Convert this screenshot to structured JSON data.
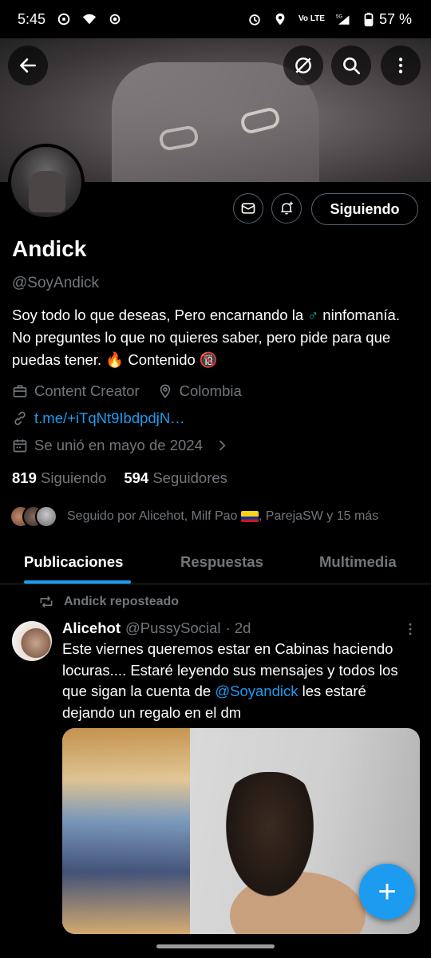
{
  "status_bar": {
    "time": "5:45",
    "battery": "57 %",
    "network": "5G",
    "volte": "Vo LTE",
    "icons": [
      "uber-icon",
      "wifi-icon",
      "hotspot-icon",
      "alarm-icon",
      "location-icon",
      "signal-icon",
      "battery-icon"
    ]
  },
  "header": {
    "back_icon": "arrow-left-icon",
    "grok_icon": "grok-icon",
    "search_icon": "search-icon",
    "more_icon": "more-vertical-icon"
  },
  "profile": {
    "name": "Andick",
    "handle": "@SoyAndick",
    "bio_part1": "Soy todo lo que deseas, Pero encarnando la ",
    "bio_male_sign": "♂",
    "bio_part2": " ninfomanía. No preguntes lo que no quieres saber, pero pide para que puedas tener. 🔥 Contenido 🔞",
    "category": "Content Creator",
    "location": "Colombia",
    "link": "t.me/+iTqNt9IbdpdjN…",
    "joined": "Se unió en mayo de 2024",
    "following_count": "819",
    "following_label": "Siguiendo",
    "followers_count": "594",
    "followers_label": "Seguidores",
    "followed_by_prefix": "Seguido por Alicehot, Milf Pao ",
    "followed_by_suffix": ", ParejaSW y 15 más",
    "follow_button": "Siguiendo"
  },
  "tabs": [
    {
      "label": "Publicaciones",
      "active": true
    },
    {
      "label": "Respuestas",
      "active": false
    },
    {
      "label": "Multimedia",
      "active": false
    }
  ],
  "tweet": {
    "repost_label": "Andick reposteado",
    "author_name": "Alicehot",
    "author_handle": "@PussySocial",
    "time": "· 2d",
    "text_part1": "Este viernes queremos estar en Cabinas haciendo locuras.... Estaré leyendo sus mensajes y todos los que sigan la cuenta de ",
    "mention": "@Soyandick",
    "text_part2": " les estaré dejando un regalo en el dm"
  },
  "fab": {
    "label": "+"
  },
  "colors": {
    "accent": "#1d9bf0",
    "muted": "#71767b",
    "background": "#000000"
  }
}
